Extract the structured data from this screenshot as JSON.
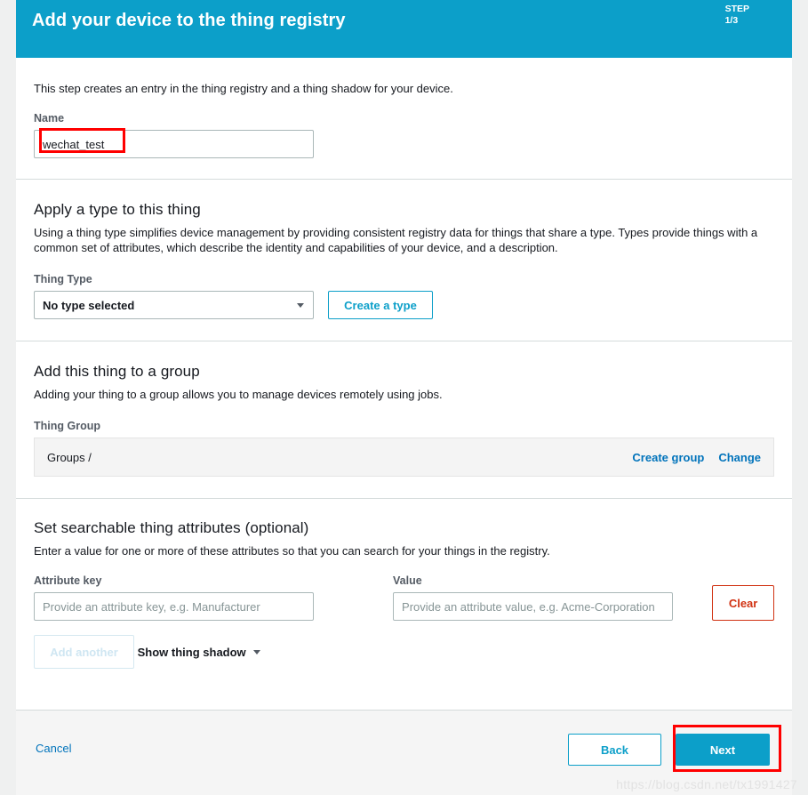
{
  "header": {
    "title": "Add your device to the thing registry",
    "step_word": "STEP",
    "step_number": "1/3",
    "background_color": "#0c9fc9"
  },
  "registry_section": {
    "description": "This step creates an entry in the thing registry and a thing shadow for your device.",
    "name_label": "Name",
    "name_value": "wechat_test"
  },
  "type_section": {
    "heading": "Apply a type to this thing",
    "description": "Using a thing type simplifies device management by providing consistent registry data for things that share a type. Types provide things with a common set of attributes, which describe the identity and capabilities of your device, and a description.",
    "thing_type_label": "Thing Type",
    "thing_type_selected": "No type selected",
    "create_type_label": "Create a type"
  },
  "group_section": {
    "heading": "Add this thing to a group",
    "description": "Adding your thing to a group allows you to manage devices remotely using jobs.",
    "thing_group_label": "Thing Group",
    "groups_path": "Groups /",
    "create_group_label": "Create group",
    "change_label": "Change"
  },
  "attributes_section": {
    "heading": "Set searchable thing attributes (optional)",
    "description": "Enter a value for one or more of these attributes so that you can search for your things in the registry.",
    "attribute_key_label": "Attribute key",
    "attribute_key_placeholder": "Provide an attribute key, e.g. Manufacturer",
    "attribute_key_value": "",
    "value_label": "Value",
    "value_placeholder": "Provide an attribute value, e.g. Acme-Corporation",
    "value_value": "",
    "clear_label": "Clear",
    "add_another_label": "Add another",
    "show_thing_shadow_label": "Show thing shadow"
  },
  "footer": {
    "cancel_label": "Cancel",
    "back_label": "Back",
    "next_label": "Next"
  },
  "watermark": {
    "text": "https://blog.csdn.net/tx1991427"
  },
  "colors": {
    "accent": "#0c9fc9",
    "link": "#0073bb",
    "danger": "#d13212",
    "annotation": "#ff0000"
  }
}
